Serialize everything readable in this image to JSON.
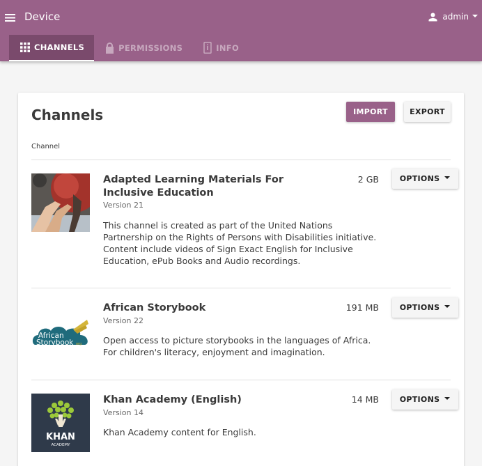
{
  "app": {
    "title": "Device",
    "user": "admin"
  },
  "tabs": [
    {
      "label": "CHANNELS",
      "icon": "apps-grid-icon",
      "active": true
    },
    {
      "label": "PERMISSIONS",
      "icon": "lock-icon",
      "active": false
    },
    {
      "label": "INFO",
      "icon": "device-info-icon",
      "active": false
    }
  ],
  "card": {
    "title": "Channels",
    "import_label": "IMPORT",
    "export_label": "EXPORT",
    "column_header": "Channel"
  },
  "channels": [
    {
      "name": "Adapted Learning Materials For Inclusive Education",
      "version": "Version 21",
      "description": "This channel is created as part of the United Nations Partnership on the Rights of Persons with Disabilities initiative. Content include videos of Sign Exact English for Inclusive Education, ePub Books and Audio recordings.",
      "size": "2 GB",
      "options_label": "OPTIONS"
    },
    {
      "name": "African Storybook",
      "version": "Version 22",
      "description": "Open access to picture storybooks in the languages of Africa. For children's literacy, enjoyment and imagination.",
      "size": "191 MB",
      "options_label": "OPTIONS",
      "logo_text": [
        "African",
        "Storybook",
        "org"
      ]
    },
    {
      "name": "Khan Academy (English)",
      "version": "Version 14",
      "description": "Khan Academy content for English.",
      "size": "14 MB",
      "options_label": "OPTIONS",
      "logo_text": [
        "KHAN",
        "ACADEMY"
      ]
    }
  ],
  "colors": {
    "brand": "#996189",
    "brand_dark": "#7a4a6c"
  }
}
